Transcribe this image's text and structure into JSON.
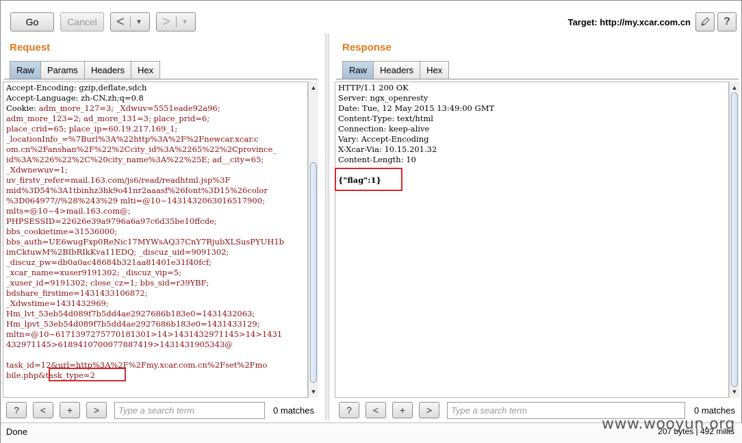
{
  "toolbar": {
    "go_label": "Go",
    "cancel_label": "Cancel",
    "back_arrow": "<",
    "forward_arrow": ">",
    "dropdown_glyph": "▼",
    "target_text": "Target: http://my.xcar.com.cn",
    "edit_icon": "pencil-icon",
    "help_icon": "help-icon",
    "help_glyph": "?"
  },
  "request": {
    "title": "Request",
    "tabs": [
      "Raw",
      "Params",
      "Headers",
      "Hex"
    ],
    "active_tab": "Raw",
    "lines": [
      "Accept-Encoding: gzip,deflate,sdch",
      "Accept-Language: zh-CN,zh;q=0.8",
      "Cookie: adm_more_127=3; _Xdwuv=5551eade92a96;",
      "adm_more_123=2; ad_more_131=3; place_prid=6;",
      "place_crid=65; place_ip=60.19.217.169_1;",
      "_locationInfo_=%7Burl%3A%22http%3A%2F%2Fnewcar.xcar.c",
      "om.cn%2Fanshan%2F%22%2Ccity_id%3A%2265%22%2Cprovince_",
      "id%3A%226%22%2C%20city_name%3A%22%25E; ad__city=65;",
      "_Xdwnewuv=1;",
      "uv_firstv_refer=mail.163.com/js6/read/readhtml.jsp%3F",
      "mid%3D54%3A1tbinhz3hk9o41nr2aaasf%26font%3D15%26color",
      "%3D064977//%28%243%29 mlti=@10~1431432063016517900;",
      "mlts=@10~4>mail.163.com@;",
      "PHPSESSID=22626e39a9796a6a97c6d35be10ffcde;",
      "bbs_cookietime=31536000;",
      "bbs_auth=UE6wugFxp0ReNic17MYWsAQ37CnY7RjubXLSusPYUH1b",
      "imCktuwM%2BIbRIkKva11EDQ; _discuz_uid=9091302;",
      "_discuz_pw=db0a0ac48684b321aa81401e31f40fcf;",
      "_xcar_name=xuser9191302; _discuz_vip=5;",
      "_xuser_id=9191302; close_cz=1; bbs_sid=r39YBF;",
      "bdshare_firstime=1431433106872;",
      "_Xdwstime=1431432969;",
      "Hm_lvt_53eb54d089f7b5dd4ae2927686b183e0=1431432063;",
      "Hm_lpvt_53eb54d089f7b5dd4ae2927686b183e0=1431433129;",
      "mltn=@10~6171397275770181301>14>1431432971145>14>1431",
      "432971145>6189410700077887419>1431431905343@",
      "",
      "task_id=12&url=http%3A%2F%2Fmy.xcar.com.cn%2Fset%2Fmo",
      "bile.php&task_type=2"
    ],
    "search_placeholder": "Type a search term",
    "matches": "0 matches"
  },
  "response": {
    "title": "Response",
    "tabs": [
      "Raw",
      "Headers",
      "Hex"
    ],
    "active_tab": "Raw",
    "lines": [
      "HTTP/1.1 200 OK",
      "Server: ngx_openresty",
      "Date: Tue, 12 May 2015 13:49:00 GMT",
      "Content-Type: text/html",
      "Connection: keep-alive",
      "Vary: Accept-Encoding",
      "X-Xcar-Via: 10.15.201.32",
      "Content-Length: 10"
    ],
    "body": "{\"flag\":1}",
    "search_placeholder": "Type a search term",
    "matches": "0 matches"
  },
  "search_buttons": {
    "help": "?",
    "prev": "<",
    "add": "+",
    "next": ">"
  },
  "status": {
    "left": "Done",
    "right": "207 bytes | 492 millis"
  },
  "watermark": "www.wooyun.org",
  "colors": {
    "pane_title": "#e47a1a",
    "highlight_box": "#d8262a",
    "request_value": "#8a1010",
    "active_tab": "#a8c0d8"
  }
}
